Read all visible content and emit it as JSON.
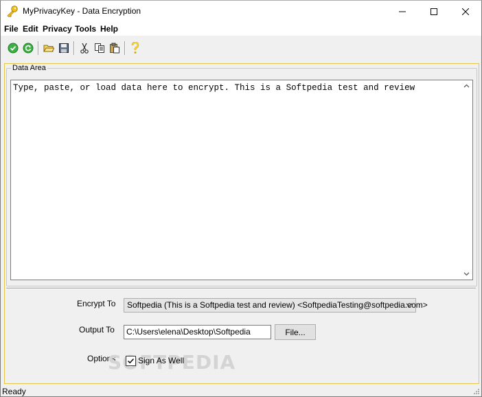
{
  "window": {
    "title": "MyPrivacyKey - Data Encryption"
  },
  "menu": [
    "File",
    "Edit",
    "Privacy",
    "Tools",
    "Help"
  ],
  "toolbar": {
    "icons": [
      "encrypt-check-icon",
      "refresh-icon",
      "open-folder-icon",
      "save-icon",
      "cut-icon",
      "copy-icon",
      "paste-icon",
      "help-icon"
    ]
  },
  "data_area": {
    "label": "Data Area",
    "text": "Type, paste, or load data here to encrypt. This is a Softpedia test and review"
  },
  "form": {
    "encrypt_to_label": "Encrypt To",
    "encrypt_to_value": "Softpedia (This is a Softpedia test and review) <SoftpediaTesting@softpedia.com>",
    "output_to_label": "Output To",
    "output_to_value": "C:\\Users\\elena\\Desktop\\Softpedia",
    "file_button": "File...",
    "options_label": "Options",
    "sign_as_well": "Sign As Well",
    "sign_checked": true
  },
  "watermark": "SOFTPEDIA",
  "status": "Ready",
  "colors": {
    "panel_border": "#e3c64b",
    "accent_green": "#2e9e2e"
  }
}
